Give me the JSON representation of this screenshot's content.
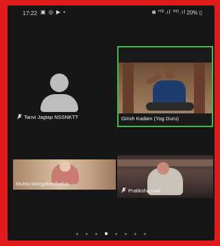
{
  "status_bar": {
    "time": "17:22",
    "left_icons": "▣ ◎ ▶ •",
    "right_icons": "◙ ᴴᴰ.ıl ᴴᴰ.ıl",
    "battery": "20% ▯"
  },
  "participants": [
    {
      "name": "Tanvi Jagtap NSSNKTT",
      "video": "avatar",
      "muted": true
    },
    {
      "name": "Girish Kadam (Yog Guru)",
      "video": "on",
      "active_speaker": true
    },
    {
      "name": "Mukta Mangalvedhekar",
      "video": "on"
    },
    {
      "name": "Pratiksha mali",
      "video": "on",
      "muted": true
    }
  ],
  "pager": {
    "count": 8,
    "active_index": 3
  },
  "colors": {
    "frame": "#e01c1c",
    "active_speaker_border": "#3fbe45",
    "background": "#161616"
  }
}
